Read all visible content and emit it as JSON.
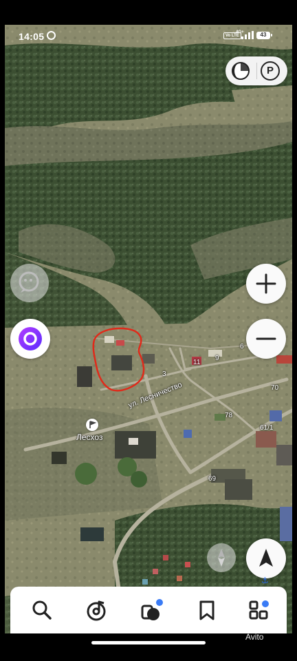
{
  "status_bar": {
    "time": "14:05",
    "volte": "Vo LTE",
    "network": "4G+",
    "battery": "43"
  },
  "map": {
    "labels": {
      "street": "ул. Лесничество",
      "place": "Лесхоз",
      "house_3": "3",
      "house_6": "6",
      "house_9": "9",
      "house_11": "11",
      "house_61": "61/1",
      "house_69": "69",
      "house_70": "70",
      "house_78": "78"
    },
    "highlight_color": "#e02a1a"
  },
  "controls": {
    "layers_icon": "half-moon-icon",
    "parking_label": "P",
    "zoom_in_icon": "plus-icon",
    "zoom_out_icon": "minus-icon",
    "locate_icon": "navigation-arrow-icon",
    "assistant_color": "#7a3cff"
  },
  "bottom_nav": {
    "items": [
      "search-icon",
      "music-icon",
      "transport-icon",
      "bookmark-icon",
      "services-icon"
    ],
    "badge_color": "#3a7bf5"
  },
  "watermark": "Avito"
}
